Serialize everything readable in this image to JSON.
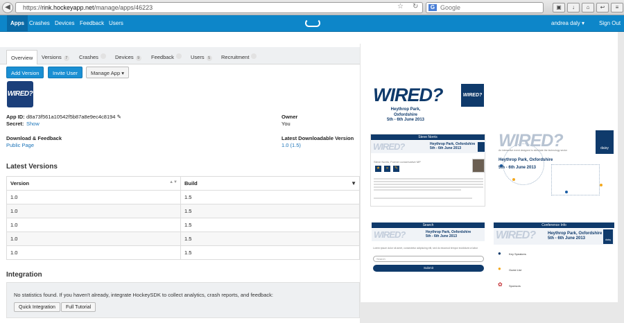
{
  "browser": {
    "url_prefix": "https://",
    "url_host": "rink.hockeyapp.net",
    "url_path": "/manage/apps/46223",
    "search_placeholder": "Google",
    "search_engine": "G"
  },
  "topnav": {
    "items": [
      "Apps",
      "Crashes",
      "Devices",
      "Feedback",
      "Users"
    ],
    "user": "andrea daly",
    "signout": "Sign Out"
  },
  "tabs": [
    {
      "label": "Overview",
      "count": ""
    },
    {
      "label": "Versions",
      "count": "7"
    },
    {
      "label": "Crashes",
      "count": ""
    },
    {
      "label": "Devices",
      "count": "9"
    },
    {
      "label": "Feedback",
      "count": ""
    },
    {
      "label": "Users",
      "count": "5"
    },
    {
      "label": "Recruitment",
      "count": ""
    }
  ],
  "actions": {
    "add_version": "Add Version",
    "invite_user": "Invite User",
    "manage_app": "Manage App"
  },
  "app": {
    "icon_text": "WIRED?",
    "app_id_label": "App ID:",
    "app_id": "d8a73f561a10542f5b87a8e9ec4c8194",
    "secret_label": "Secret:",
    "secret_link": "Show",
    "owner_label": "Owner",
    "owner": "You",
    "download_label": "Download & Feedback",
    "download_link": "Public Page",
    "latest_label": "Latest Downloadable Version",
    "latest_version": "1.0 (1.5)"
  },
  "versions": {
    "title": "Latest Versions",
    "headers": [
      "Version",
      "Build"
    ],
    "rows": [
      [
        "1.0",
        "1.5"
      ],
      [
        "1.0",
        "1.5"
      ],
      [
        "1.0",
        "1.5"
      ],
      [
        "1.0",
        "1.5"
      ],
      [
        "1.0",
        "1.5"
      ]
    ]
  },
  "integration": {
    "title": "Integration",
    "message": "No statistics found. If you haven't already, integrate HockeySDK to collect analytics, crash reports, and feedback:",
    "quick": "Quick Integration",
    "tutorial": "Full Tutorial"
  },
  "screens": {
    "brand": "WIRED?",
    "venue": "Heythrop Park, Oxfordshire",
    "venue_short": "Heythrop Park,",
    "venue_short2": "Oxfordshire",
    "dates": "5th - 6th June 2013",
    "speaker_header": "Steve Norris",
    "speaker_subtitle": "Steve Norris, Former conservative MP",
    "search_header": "Search",
    "search_hint": "Lorem ipsum dolor sit amet, consectetur adipiscing elit, sed do eiusmod tempor incididunt ut labor",
    "search_placeholder": "Search",
    "submit": "Submit",
    "conference_header": "Conference Info",
    "conference_items": [
      "Key Speakers",
      "Guest List",
      "Sponsors"
    ],
    "daisy": "daisy",
    "tagline": "An interactive event designed to stimulate the technology sector"
  },
  "colors": {
    "accent": "#0d86c9",
    "navy": "#0f3a6b",
    "button_blue": "#1a8fd3"
  }
}
